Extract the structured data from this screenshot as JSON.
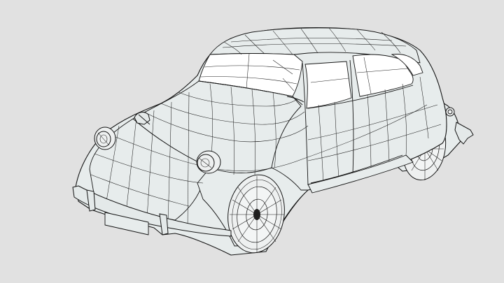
{
  "scene": {
    "subject_icon": "wireframe-car-model-icon",
    "background_color": "#e1e1e1",
    "surface_color": "#e7ecec",
    "wire_color": "#1e1e1e",
    "glass_color": "#ffffff"
  }
}
